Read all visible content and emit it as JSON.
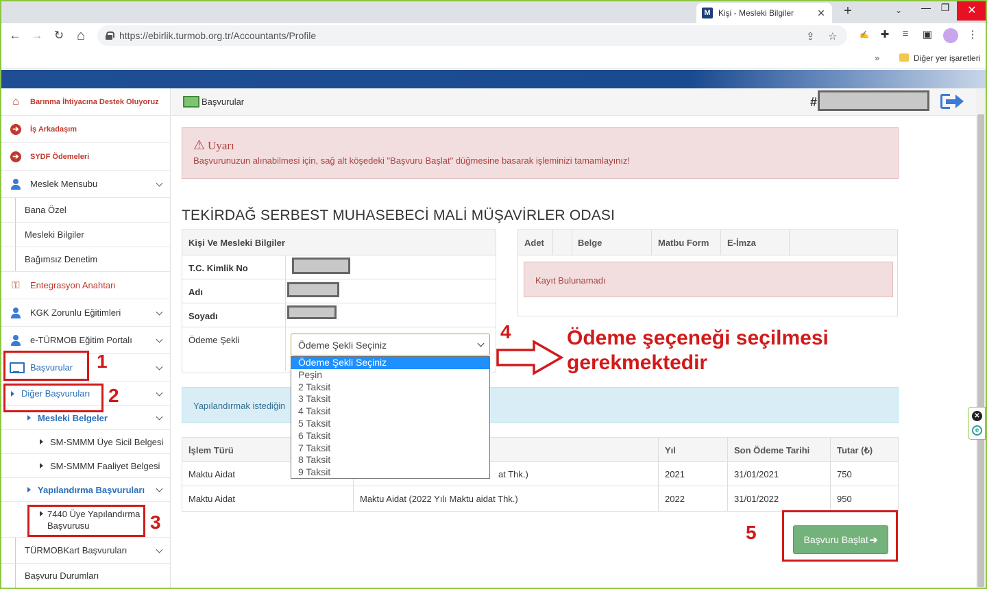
{
  "browser": {
    "tab_title": "Kişi - Mesleki Bilgiler",
    "tab_favicon": "M",
    "close_glyph": "✕",
    "new_tab_glyph": "+",
    "tab_search_glyph": "⌄",
    "minimize_glyph": "—",
    "restore_glyph": "❐",
    "url": "https://ebirlik.turmob.org.tr/Accountants/Profile",
    "bookmarks_overflow": "»",
    "bookmark_folder_label": "Diğer yer işaretleri",
    "back_icon": "←",
    "forward_icon": "→",
    "reload_icon": "↻",
    "home_icon": "⌂",
    "share_icon": "⇪",
    "star_icon": "☆",
    "extensions_icon": "✚",
    "menu_icon": "⋮"
  },
  "sidebar": {
    "items": [
      {
        "label": "Barınma İhtiyacına Destek Oluyoruz",
        "icon": "home-icon"
      },
      {
        "label": "İş Arkadaşım",
        "icon": "circle-arrow-icon"
      },
      {
        "label": "SYDF Ödemeleri",
        "icon": "circle-arrow-icon"
      },
      {
        "label": "Meslek Mensubu",
        "icon": "user-icon"
      },
      {
        "label": "Bana Özel"
      },
      {
        "label": "Mesleki Bilgiler"
      },
      {
        "label": "Bağımsız Denetim"
      },
      {
        "label": "Entegrasyon Anahtarı",
        "icon": "key-icon"
      },
      {
        "label": "KGK Zorunlu Eğitimleri",
        "icon": "user-icon"
      },
      {
        "label": "e-TÜRMOB Eğitim Portalı",
        "icon": "user-icon"
      },
      {
        "label": "Başvurular",
        "icon": "monitor-icon"
      },
      {
        "label": "Diğer Başvuruları"
      },
      {
        "label": "Mesleki Belgeler"
      },
      {
        "label": "SM-SMMM Üye Sicil Belgesi"
      },
      {
        "label": "SM-SMMM Faaliyet Belgesi"
      },
      {
        "label": "Yapılandırma Başvuruları"
      },
      {
        "label": "7440 Üye Yapılandırma Başvurusu"
      },
      {
        "label": "TÜRMOBKart Başvuruları"
      },
      {
        "label": "Başvuru Durumları"
      }
    ],
    "home_glyph": "⌂",
    "arrow_glyph": "➔",
    "key_glyph": "⚿"
  },
  "header": {
    "title": "Başvurular",
    "hash": "#"
  },
  "alert": {
    "icon": "⚠",
    "title": "Uyarı",
    "message": "Başvurunuzun alınabilmesi için, sağ alt köşedeki \"Başvuru Başlat\" düğmesine basarak işleminizi tamamlayınız!"
  },
  "org_title": "TEKİRDAĞ SERBEST MUHASEBECİ MALİ MÜŞAVİRLER ODASI",
  "person_panel": {
    "heading": "Kişi Ve Mesleki Bilgiler",
    "tc_label": "T.C. Kimlik No",
    "name_label": "Adı",
    "surname_label": "Soyadı",
    "payment_label": "Ödeme Şekli",
    "payment_selected": "Ödeme Şekli Seçiniz",
    "payment_options": [
      "Ödeme Şekli Seçiniz",
      "Peşin",
      "2 Taksit",
      "3 Taksit",
      "4 Taksit",
      "5 Taksit",
      "6 Taksit",
      "7 Taksit",
      "8 Taksit",
      "9 Taksit"
    ]
  },
  "docs_panel": {
    "columns": [
      "Adet",
      "Belge",
      "Matbu Form",
      "E-İmza"
    ],
    "empty_message": "Kayıt Bulunamadı"
  },
  "info_bar": {
    "text": "Yapılandırmak istediğin"
  },
  "fees_table": {
    "columns": [
      "İşlem Türü",
      "",
      "Yıl",
      "Son Ödeme Tarihi",
      "Tutar (₺)"
    ],
    "rows": [
      [
        "Maktu Aidat",
        "at Thk.)",
        "2021",
        "31/01/2021",
        "750"
      ],
      [
        "Maktu Aidat",
        "Maktu Aidat (2022 Yılı Maktu aidat Thk.)",
        "2022",
        "31/01/2022",
        "950"
      ]
    ]
  },
  "start_button": {
    "label": "Başvuru Başlat",
    "arrow": "➔"
  },
  "annotations": {
    "n1": "1",
    "n2": "2",
    "n3": "3",
    "n4": "4",
    "n5": "5",
    "callout_line1": "Ödeme şeçeneği seçilmesi",
    "callout_line2": "gerekmektedir",
    "color": "#d11a1a"
  },
  "widget": {
    "close_glyph": "✕",
    "e_glyph": "e"
  }
}
